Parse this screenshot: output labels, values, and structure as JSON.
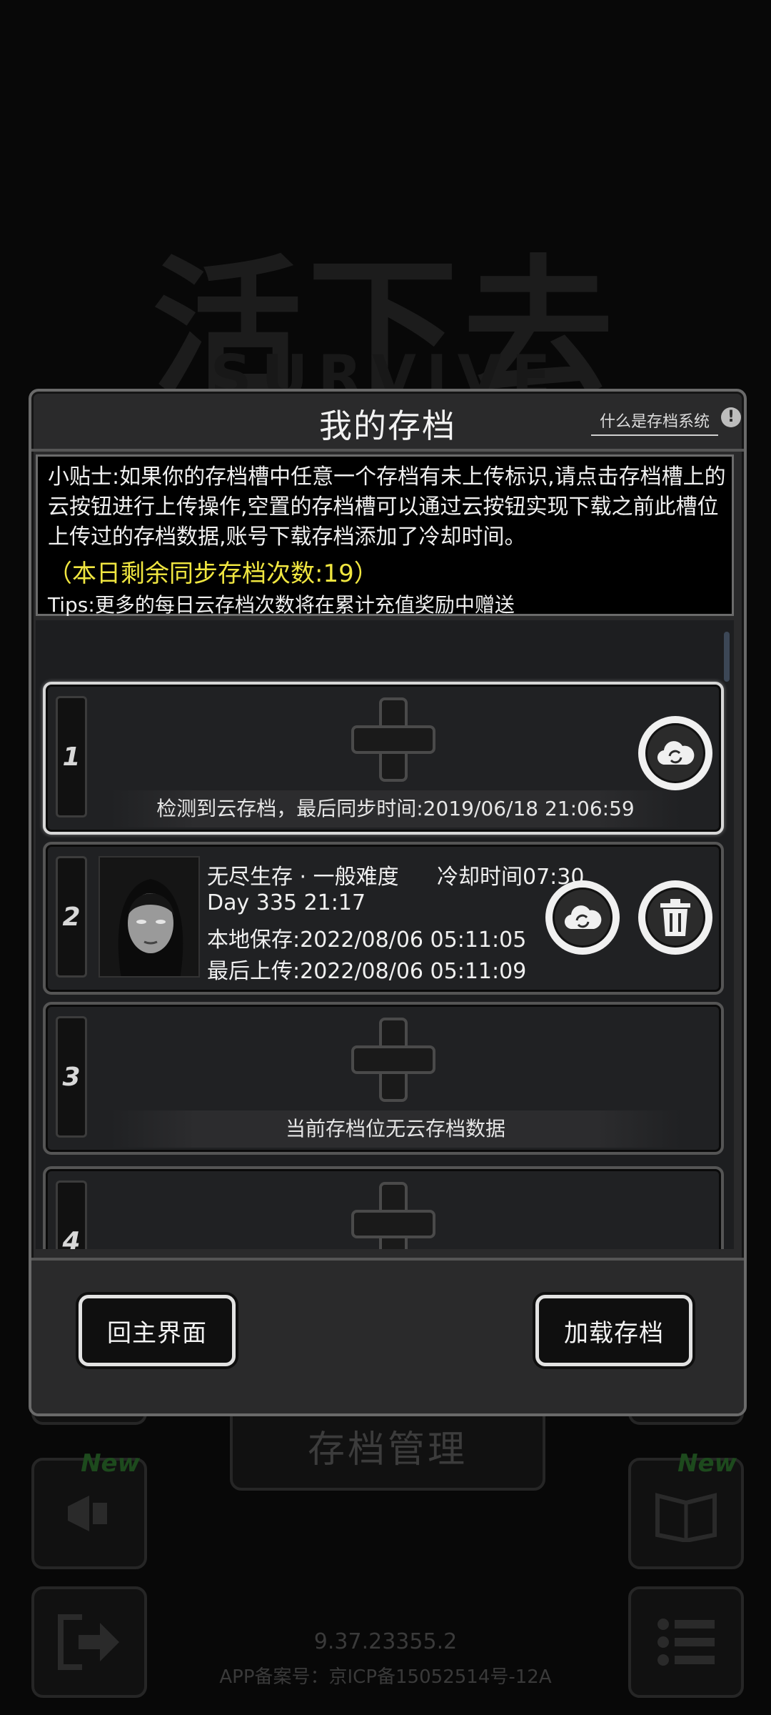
{
  "background": {
    "logo_text": "活下去",
    "logo_sub": "SURVIVE",
    "save_manager_label": "存档管理",
    "new_badge": "New",
    "version": "9.37.23355.2",
    "icp": "APP备案号：京ICP备15052514号-12A"
  },
  "dialog": {
    "title": "我的存档",
    "what_is_link": "什么是存档系统",
    "info_icon": "exclamation-icon",
    "tips": {
      "body": "小贴士:如果你的存档槽中任意一个存档有未上传标识,请点击存档槽上的云按钮进行上传操作,空置的存档槽可以通过云按钮实现下载之前此槽位上传过的存档数据,账号下载存档添加了冷却时间。",
      "sync_count": "（本日剩余同步存档次数:19）",
      "footer": "Tips:更多的每日云存档次数将在累计充值奖励中赠送",
      "sync_color": "#f0e640"
    },
    "slots": [
      {
        "number": "1",
        "message": "检测到云存档，最后同步时间:2019/06/18  21:06:59"
      },
      {
        "number": "2",
        "mode": "无尽生存 · 一般难度",
        "cooldown": "冷却时间07:30",
        "day": "Day 335  21:17",
        "local_save": "本地保存:2022/08/06  05:11:05",
        "last_upload": "最后上传:2022/08/06  05:11:09"
      },
      {
        "number": "3",
        "message": "当前存档位无云存档数据"
      },
      {
        "number": "4"
      }
    ],
    "footer": {
      "home_button": "回主界面",
      "load_button": "加载存档"
    }
  }
}
